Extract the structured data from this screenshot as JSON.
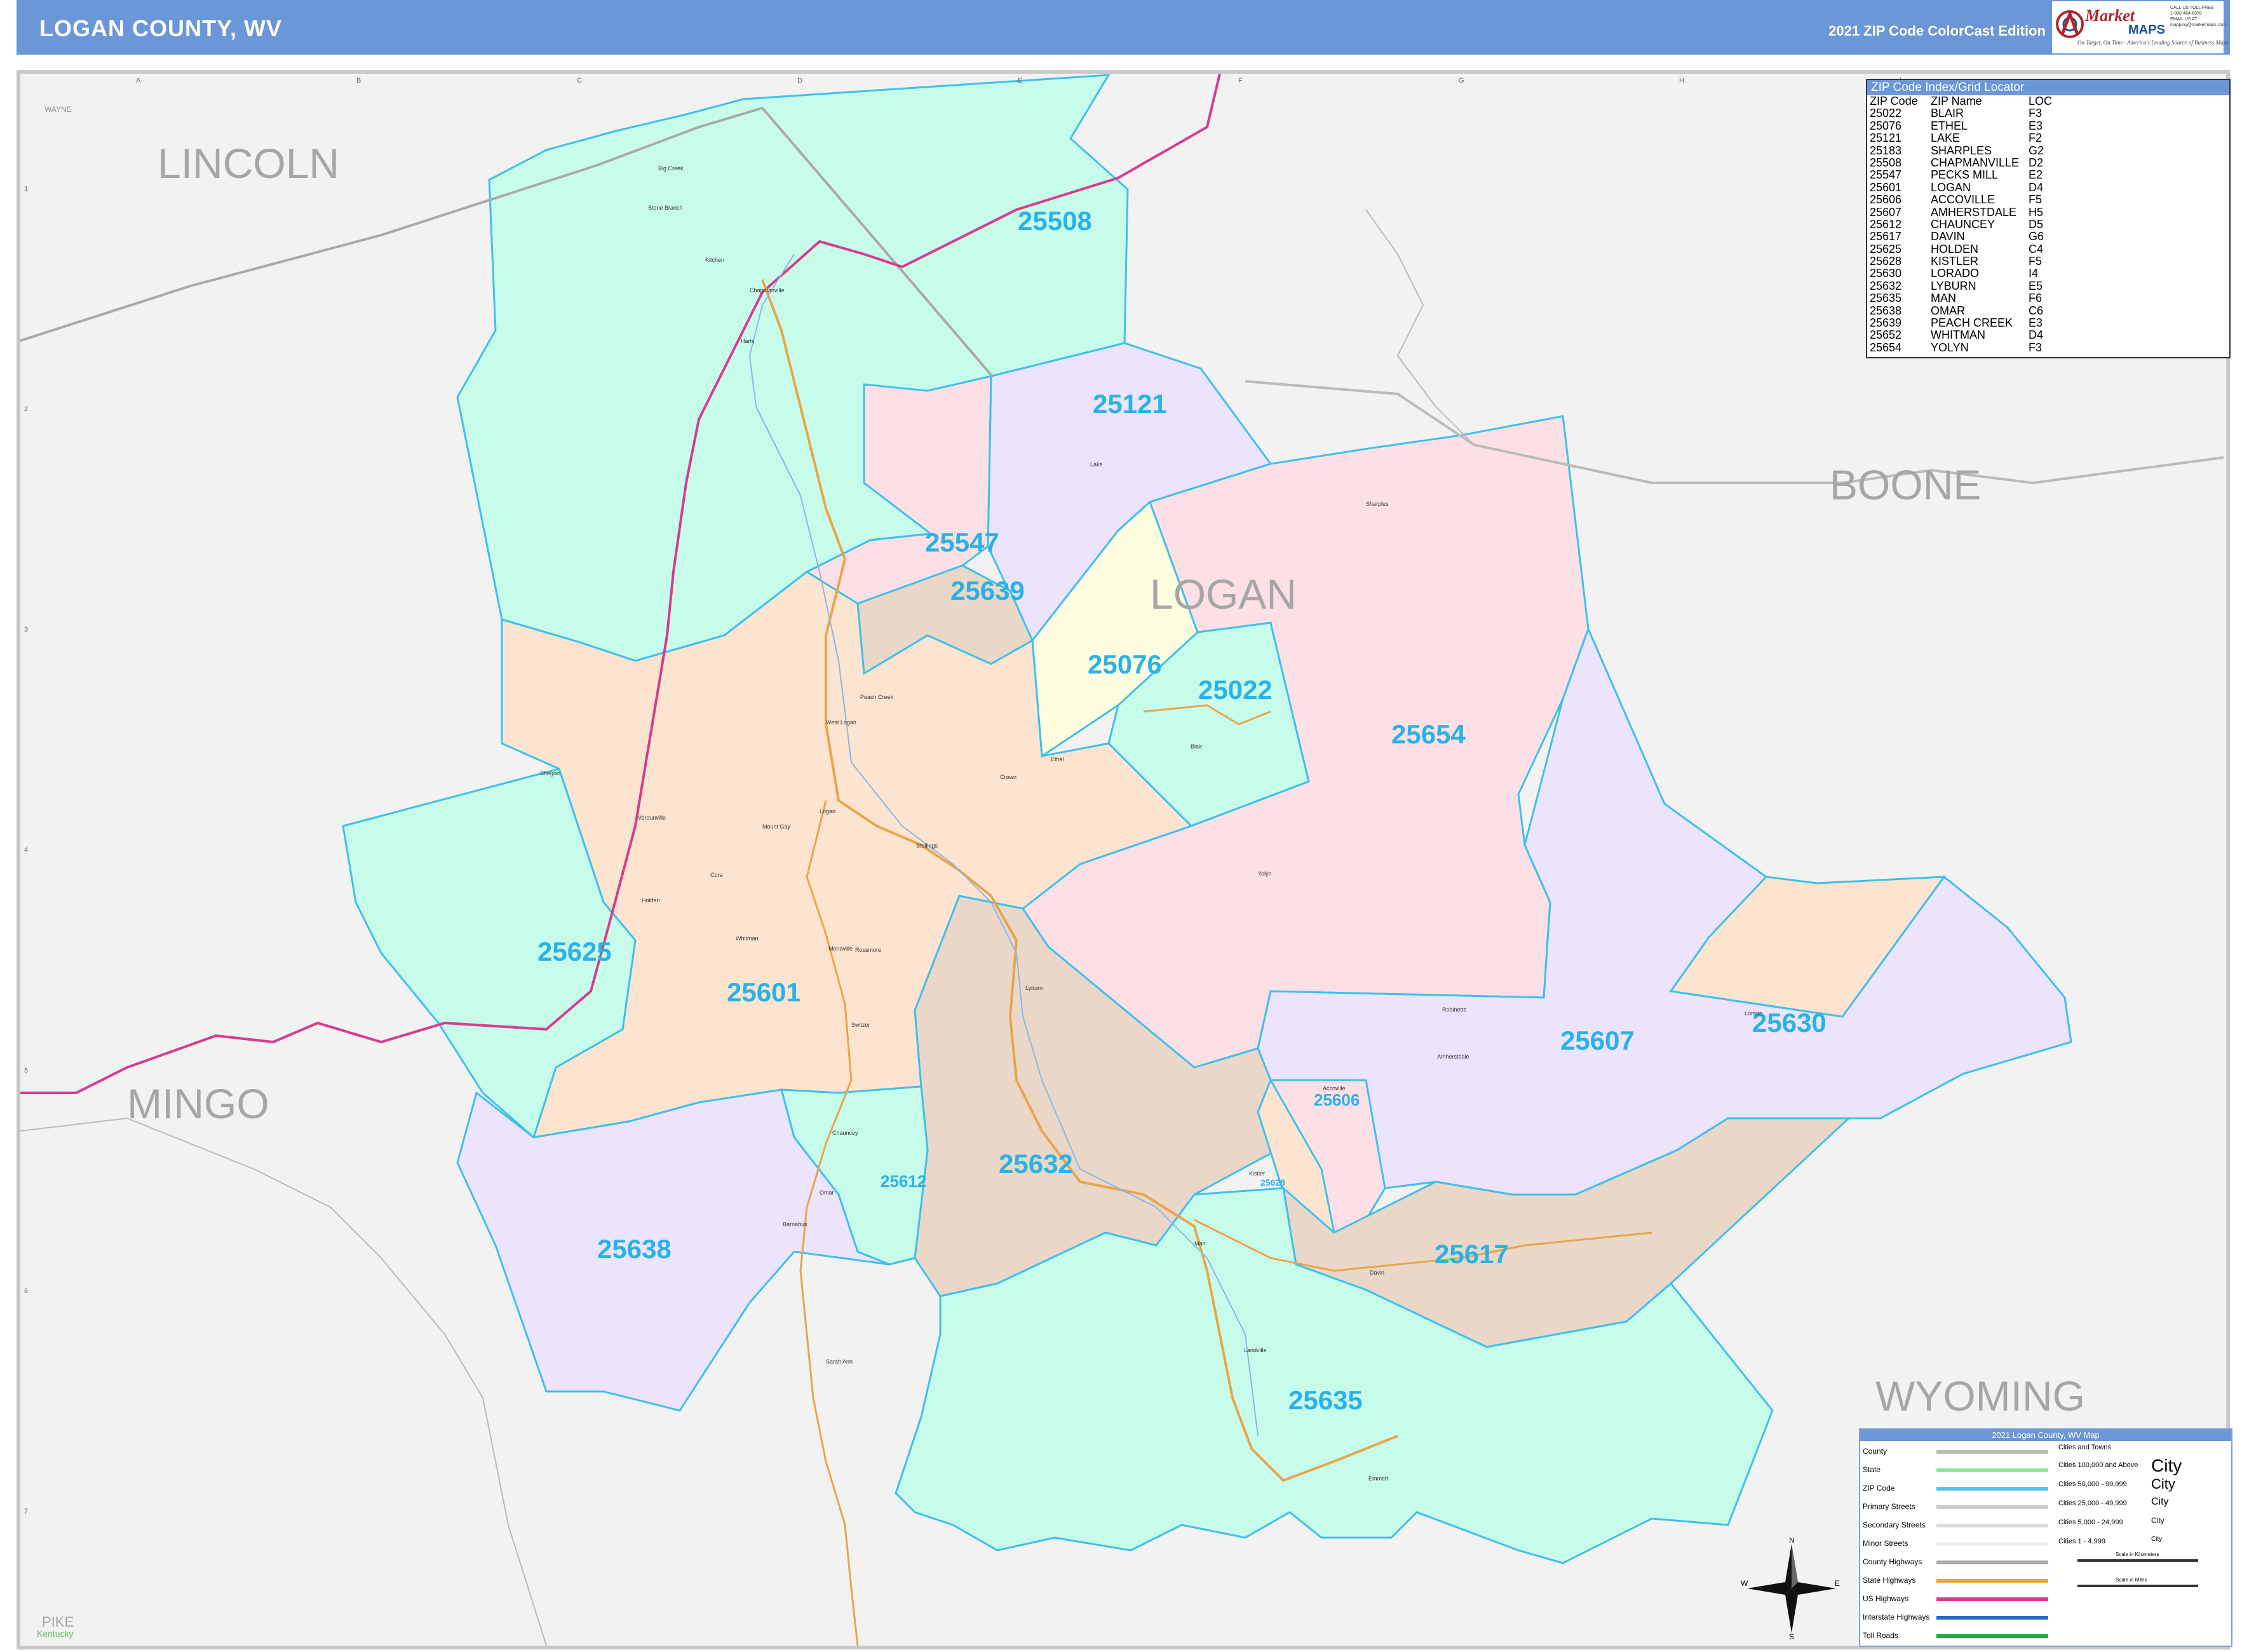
{
  "header": {
    "title": "LOGAN COUNTY, WV",
    "edition": "2021 ZIP Code ColorCast Edition",
    "logo_text": "Market",
    "logo_maps": "MAPS",
    "logo_tagline": "America's Leading Source of Business Maps",
    "logo_slogan": "On Target, On Time",
    "logo_contact": [
      "CALL US TOLL FREE",
      "1-800-464-6970",
      "EMAIL US AT",
      "mapping@marketmaps.com"
    ]
  },
  "map": {
    "grid_columns": [
      "A",
      "B",
      "C",
      "D",
      "E",
      "F",
      "G",
      "H",
      "I"
    ],
    "grid_rows": [
      "1",
      "2",
      "3",
      "4",
      "5",
      "6",
      "7"
    ],
    "counties": [
      "LINCOLN",
      "BOONE",
      "LOGAN",
      "MINGO",
      "WYOMING",
      "PIKE",
      "WAYNE"
    ],
    "zips": [
      "25508",
      "25121",
      "25547",
      "25639",
      "25076",
      "25022",
      "25654",
      "25601",
      "25625",
      "25607",
      "25630",
      "25606",
      "25612",
      "25632",
      "25628",
      "25617",
      "25638",
      "25635"
    ],
    "cities": [
      "Big Creek",
      "Stone Branch",
      "Kitchen",
      "Chapmanville",
      "Harts",
      "Sharples",
      "Logan",
      "Man",
      "Holden",
      "Peach Creek",
      "Chauncey",
      "Omar",
      "Davin",
      "Lorado",
      "Ethel",
      "Yolyn",
      "Whitman",
      "Accoville",
      "Kistler",
      "Stollings",
      "Verdunville",
      "Sarah Ann",
      "Switzer",
      "Mount Gay",
      "Amherstdale",
      "Landville",
      "Crown",
      "Lyburn",
      "Robinette",
      "Emmett",
      "Lake",
      "Blair",
      "Monaville",
      "West Logan",
      "Rossmore",
      "Ethel",
      "Barnabus",
      "Shegon",
      "Cora"
    ],
    "state_label": "Kentucky"
  },
  "zip_index": {
    "title": "ZIP Code Index/Grid Locator",
    "headers": [
      "ZIP Code",
      "ZIP Name",
      "LOC"
    ],
    "rows": [
      [
        "25022",
        "BLAIR",
        "F3"
      ],
      [
        "25076",
        "ETHEL",
        "E3"
      ],
      [
        "25121",
        "LAKE",
        "F2"
      ],
      [
        "25183",
        "SHARPLES",
        "G2"
      ],
      [
        "25508",
        "CHAPMANVILLE",
        "D2"
      ],
      [
        "25547",
        "PECKS MILL",
        "E2"
      ],
      [
        "25601",
        "LOGAN",
        "D4"
      ],
      [
        "25606",
        "ACCOVILLE",
        "F5"
      ],
      [
        "25607",
        "AMHERSTDALE",
        "H5"
      ],
      [
        "25612",
        "CHAUNCEY",
        "D5"
      ],
      [
        "25617",
        "DAVIN",
        "G6"
      ],
      [
        "25625",
        "HOLDEN",
        "C4"
      ],
      [
        "25628",
        "KISTLER",
        "F5"
      ],
      [
        "25630",
        "LORADO",
        "I4"
      ],
      [
        "25632",
        "LYBURN",
        "E5"
      ],
      [
        "25635",
        "MAN",
        "F6"
      ],
      [
        "25638",
        "OMAR",
        "C6"
      ],
      [
        "25639",
        "PEACH CREEK",
        "E3"
      ],
      [
        "25652",
        "WHITMAN",
        "D4"
      ],
      [
        "25654",
        "YOLYN",
        "F3"
      ]
    ]
  },
  "legend": {
    "title": "2021 Logan County, WV Map",
    "items": [
      "County",
      "State",
      "ZIP Code",
      "Primary Streets",
      "Secondary Streets",
      "Minor Streets",
      "County Highways",
      "State Highways",
      "US Highways",
      "Interstate Highways",
      "Toll Roads"
    ],
    "cities_title": "Cities and Towns",
    "city_ranges": [
      "Cities 100,000 and Above",
      "Cities 50,000 - 99,999",
      "Cities 25,000 - 49,999",
      "Cities 5,000 - 24,999",
      "Cities 1 - 4,999"
    ],
    "city_symbols": [
      "City",
      "City",
      "City",
      "City",
      "City"
    ],
    "scale_km": "Scale in Kilometers",
    "scale_mi": "Scale in Miles",
    "compass": [
      "N",
      "S",
      "E",
      "W"
    ],
    "colors": {
      "county": "#bbbbbb",
      "state": "#8ee89a",
      "zip": "#4fc4ec",
      "primary": "#cccccc",
      "county_hwy": "#aaaaaa",
      "state_hwy": "#e8a54a",
      "us_hwy": "#d83c8c",
      "interstate": "#2468c8",
      "toll": "#22aa44"
    }
  }
}
